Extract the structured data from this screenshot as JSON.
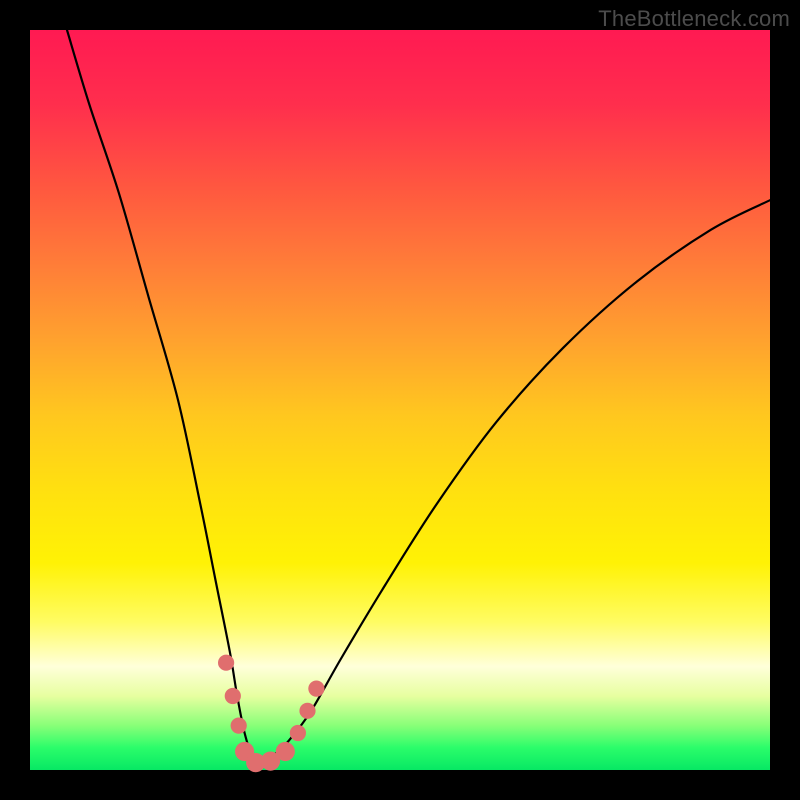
{
  "watermark": "TheBottleneck.com",
  "chart_data": {
    "type": "line",
    "title": "",
    "xlabel": "",
    "ylabel": "",
    "xlim": [
      0,
      100
    ],
    "ylim": [
      0,
      100
    ],
    "series": [
      {
        "name": "bottleneck-curve",
        "x": [
          5,
          8,
          12,
          16,
          20,
          23,
          25,
          27,
          28,
          29,
          30,
          31,
          32,
          33,
          35,
          38,
          42,
          48,
          55,
          63,
          72,
          82,
          92,
          100
        ],
        "y": [
          100,
          90,
          78,
          64,
          50,
          36,
          26,
          16,
          10,
          5,
          2,
          1,
          1,
          2,
          4,
          8,
          15,
          25,
          36,
          47,
          57,
          66,
          73,
          77
        ]
      }
    ],
    "markers": [
      {
        "x": 26.5,
        "y": 14.5,
        "r": 1.1
      },
      {
        "x": 27.4,
        "y": 10.0,
        "r": 1.1
      },
      {
        "x": 28.2,
        "y": 6.0,
        "r": 1.1
      },
      {
        "x": 29.0,
        "y": 2.5,
        "r": 1.3
      },
      {
        "x": 30.5,
        "y": 1.0,
        "r": 1.3
      },
      {
        "x": 32.5,
        "y": 1.2,
        "r": 1.3
      },
      {
        "x": 34.5,
        "y": 2.5,
        "r": 1.3
      },
      {
        "x": 36.2,
        "y": 5.0,
        "r": 1.1
      },
      {
        "x": 37.5,
        "y": 8.0,
        "r": 1.1
      },
      {
        "x": 38.7,
        "y": 11.0,
        "r": 1.1
      }
    ],
    "gradient_stops": [
      {
        "pos": 0,
        "color": "#ff1a52"
      },
      {
        "pos": 50,
        "color": "#ffc71f"
      },
      {
        "pos": 85,
        "color": "#ffffda"
      },
      {
        "pos": 100,
        "color": "#07e864"
      }
    ]
  }
}
